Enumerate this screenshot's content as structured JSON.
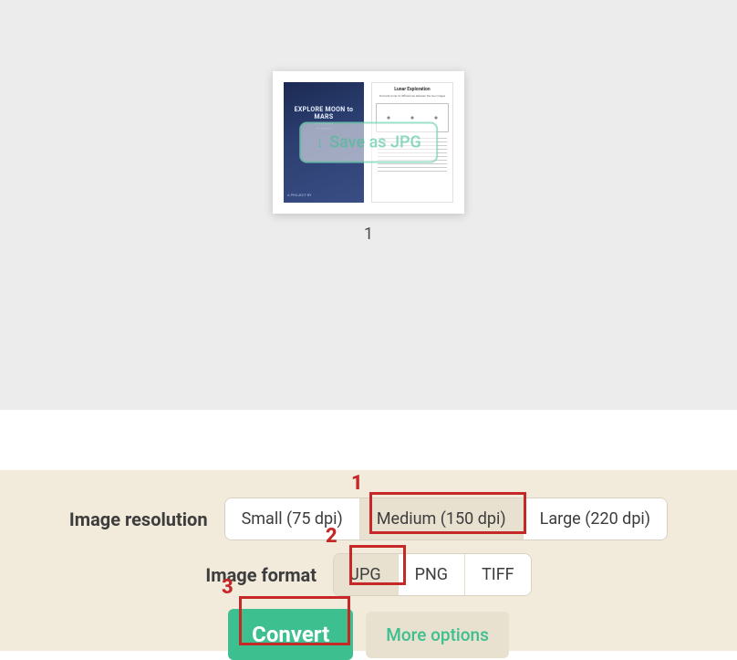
{
  "preview": {
    "thumb_left_title": "EXPLORE MOON to MARS",
    "thumb_left_footer": "A PROJECT BY",
    "thumb_right_title": "Lunar Exploration",
    "thumb_right_sub": "Find and circle 10 differences between the two images",
    "overlay_label": "Save as JPG",
    "page_number": "1"
  },
  "options": {
    "resolution_label": "Image resolution",
    "resolution_items": {
      "small": "Small (75 dpi)",
      "medium": "Medium (150 dpi)",
      "large": "Large (220 dpi)"
    },
    "format_label": "Image format",
    "format_items": {
      "jpg": "JPG",
      "png": "PNG",
      "tiff": "TIFF"
    },
    "convert_label": "Convert",
    "more_label": "More options"
  },
  "annotations": {
    "n1": "1",
    "n2": "2",
    "n3": "3"
  }
}
